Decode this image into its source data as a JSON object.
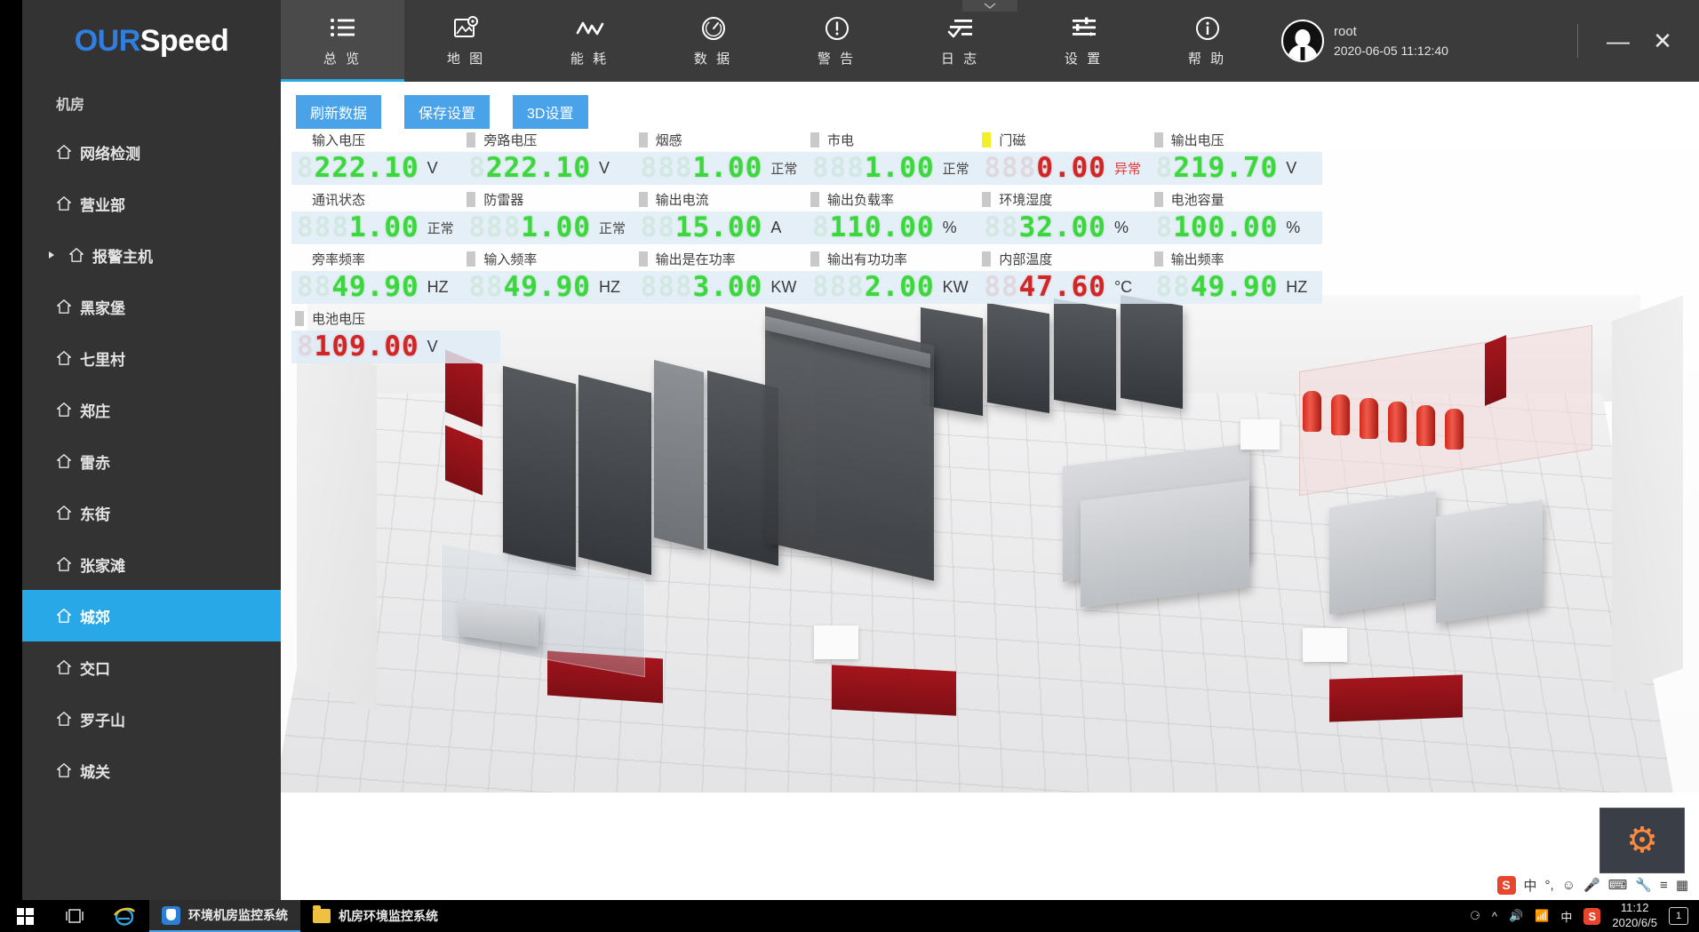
{
  "app": {
    "logo_our": "OUR",
    "logo_speed": "Speed"
  },
  "sidebar": {
    "section_label": "机房",
    "items": [
      {
        "label": "网络检测",
        "icon": "home-icon",
        "active": false,
        "caret": false
      },
      {
        "label": "营业部",
        "icon": "home-icon",
        "active": false,
        "caret": false
      },
      {
        "label": "报警主机",
        "icon": "home-icon",
        "active": false,
        "caret": true
      },
      {
        "label": "黑家堡",
        "icon": "home-icon",
        "active": false,
        "caret": false
      },
      {
        "label": "七里村",
        "icon": "home-icon",
        "active": false,
        "caret": false
      },
      {
        "label": "郑庄",
        "icon": "home-icon",
        "active": false,
        "caret": false
      },
      {
        "label": "雷赤",
        "icon": "home-icon",
        "active": false,
        "caret": false
      },
      {
        "label": "东街",
        "icon": "home-icon",
        "active": false,
        "caret": false
      },
      {
        "label": "张家滩",
        "icon": "home-icon",
        "active": false,
        "caret": false
      },
      {
        "label": "城郊",
        "icon": "home-icon",
        "active": true,
        "caret": false
      },
      {
        "label": "交口",
        "icon": "home-icon",
        "active": false,
        "caret": false
      },
      {
        "label": "罗子山",
        "icon": "home-icon",
        "active": false,
        "caret": false
      },
      {
        "label": "城关",
        "icon": "home-icon",
        "active": false,
        "caret": false
      }
    ]
  },
  "toolbar": {
    "tabs": [
      {
        "label": "总 览",
        "icon": "list-icon",
        "active": true
      },
      {
        "label": "地 图",
        "icon": "map-pin-image-icon",
        "active": false
      },
      {
        "label": "能 耗",
        "icon": "zigzag-line-icon",
        "active": false
      },
      {
        "label": "数 据",
        "icon": "gauge-icon",
        "active": false
      },
      {
        "label": "警 告",
        "icon": "exclamation-circle-icon",
        "active": false
      },
      {
        "label": "日 志",
        "icon": "log-check-icon",
        "active": false
      },
      {
        "label": "设 置",
        "icon": "sliders-icon",
        "active": false
      },
      {
        "label": "帮 助",
        "icon": "info-circle-icon",
        "active": false
      }
    ],
    "user": {
      "name": "root",
      "datetime": "2020-06-05 11:12:40"
    },
    "window_controls": {
      "minimize": "—",
      "close": "✕"
    }
  },
  "panel": {
    "buttons": [
      {
        "label": "刷新数据",
        "name": "refresh-data-button"
      },
      {
        "label": "保存设置",
        "name": "save-settings-button"
      },
      {
        "label": "3D设置",
        "name": "3d-settings-button"
      }
    ],
    "rows": [
      [
        {
          "label": "输入电压",
          "ghost": "8",
          "value": "222.10",
          "unit": "V",
          "status": "",
          "color": "green",
          "indicator": "none"
        },
        {
          "label": "旁路电压",
          "ghost": "8",
          "value": "222.10",
          "unit": "V",
          "status": "",
          "color": "green",
          "indicator": "grey"
        },
        {
          "label": "烟感",
          "ghost": "888",
          "value": "1.00",
          "unit": "",
          "status": "正常",
          "color": "green",
          "indicator": "grey"
        },
        {
          "label": "市电",
          "ghost": "888",
          "value": "1.00",
          "unit": "",
          "status": "正常",
          "color": "green",
          "indicator": "grey"
        },
        {
          "label": "门磁",
          "ghost": "888",
          "value": "0.00",
          "unit": "",
          "status": "异常",
          "color": "red",
          "indicator": "yellow"
        },
        {
          "label": "输出电压",
          "ghost": "8",
          "value": "219.70",
          "unit": "V",
          "status": "",
          "color": "green",
          "indicator": "grey"
        }
      ],
      [
        {
          "label": "通讯状态",
          "ghost": "888",
          "value": "1.00",
          "unit": "",
          "status": "正常",
          "color": "green",
          "indicator": "none"
        },
        {
          "label": "防雷器",
          "ghost": "888",
          "value": "1.00",
          "unit": "",
          "status": "正常",
          "color": "green",
          "indicator": "grey"
        },
        {
          "label": "输出电流",
          "ghost": "88",
          "value": "15.00",
          "unit": "A",
          "status": "",
          "color": "green",
          "indicator": "grey"
        },
        {
          "label": "输出负载率",
          "ghost": "8",
          "value": "110.00",
          "unit": "%",
          "status": "",
          "color": "green",
          "indicator": "grey"
        },
        {
          "label": "环境湿度",
          "ghost": "88",
          "value": "32.00",
          "unit": "%",
          "status": "",
          "color": "green",
          "indicator": "grey"
        },
        {
          "label": "电池容量",
          "ghost": "8",
          "value": "100.00",
          "unit": "%",
          "status": "",
          "color": "green",
          "indicator": "grey"
        }
      ],
      [
        {
          "label": "旁率频率",
          "ghost": "88",
          "value": "49.90",
          "unit": "HZ",
          "status": "",
          "color": "green",
          "indicator": "none"
        },
        {
          "label": "输入频率",
          "ghost": "88",
          "value": "49.90",
          "unit": "HZ",
          "status": "",
          "color": "green",
          "indicator": "grey"
        },
        {
          "label": "输出是在功率",
          "ghost": "888",
          "value": "3.00",
          "unit": "KW",
          "status": "",
          "color": "green",
          "indicator": "grey"
        },
        {
          "label": "输出有功功率",
          "ghost": "888",
          "value": "2.00",
          "unit": "KW",
          "status": "",
          "color": "green",
          "indicator": "grey"
        },
        {
          "label": "内部温度",
          "ghost": "88",
          "value": "47.60",
          "unit": "°C",
          "status": "",
          "color": "red",
          "indicator": "grey"
        },
        {
          "label": "输出频率",
          "ghost": "88",
          "value": "49.90",
          "unit": "HZ",
          "status": "",
          "color": "green",
          "indicator": "grey"
        }
      ],
      [
        {
          "label": "电池电压",
          "ghost": "8",
          "value": "109.00",
          "unit": "V",
          "status": "",
          "color": "red",
          "indicator": "grey"
        }
      ]
    ]
  },
  "ime_tray": {
    "sogou": "S",
    "mode": "中",
    "punct": "°,",
    "items": [
      "☺",
      "🎤",
      "⌨",
      "🔧",
      "≡",
      "▦"
    ]
  },
  "taskbar": {
    "tasks": [
      {
        "label": "环境机房监控系统",
        "icon": "shield-icon",
        "active": true
      },
      {
        "label": "机房环境监控系统",
        "icon": "folder-icon",
        "active": false
      }
    ],
    "tray": {
      "pen": "⚆",
      "caret": "^",
      "volume": "🔊",
      "network": "📶",
      "ime": "中",
      "sogou": "S",
      "time": "11:12",
      "date": "2020/6/5",
      "notify": "1"
    }
  },
  "colors": {
    "accent": "#29a8e8",
    "button": "#4aa3e8",
    "digit_green": "#3ed63e",
    "digit_red": "#d02626",
    "indicator_yellow": "#f5ef2a",
    "sidebar_bg": "#333333",
    "toolbar_bg": "#3b3b3b"
  }
}
